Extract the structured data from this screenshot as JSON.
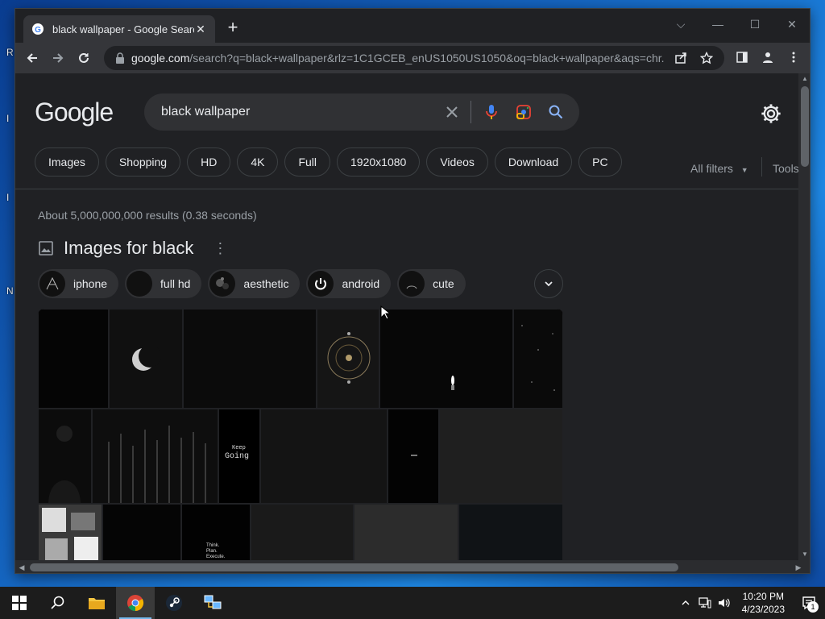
{
  "browser": {
    "tab": {
      "title": "black wallpaper - Google Search",
      "close_glyph": "✕"
    },
    "new_tab_glyph": "+",
    "window_controls": {
      "tabsearch": "⌵",
      "minimize": "—",
      "maximize": "☐",
      "close": "✕"
    },
    "address": {
      "host": "google.com",
      "path": "/search?q=black+wallpaper&rlz=1C1GCEB_enUS1050US1050&oq=black+wallpaper&aqs=chr..."
    }
  },
  "google": {
    "logo": "Google",
    "query": "black wallpaper",
    "filter_chips": [
      "Images",
      "Shopping",
      "HD",
      "4K",
      "Full",
      "1920x1080",
      "Videos",
      "Download",
      "PC"
    ],
    "all_filters": "All filters",
    "tools": "Tools",
    "stats": "About 5,000,000,000 results (0.38 seconds)",
    "images_header": "Images for black",
    "refine_chips": [
      "iphone",
      "full hd",
      "aesthetic",
      "android",
      "cute"
    ],
    "image_texts": {
      "keep_going_1": "Keep",
      "keep_going_2": "Going",
      "think_1": "Think.",
      "think_2": "Plan.",
      "think_3": "Execute."
    }
  },
  "taskbar": {
    "time": "10:20 PM",
    "date": "4/23/2023",
    "notification_count": "1"
  },
  "desktop": {
    "edge_letters": [
      "R",
      "I",
      "I",
      "N"
    ]
  },
  "colors": {
    "page_bg": "#202124",
    "toolbar_bg": "#35363a",
    "searchbox_bg": "#303134",
    "mic_blue": "#4285f4",
    "accent_blue": "#8ab4f8"
  }
}
